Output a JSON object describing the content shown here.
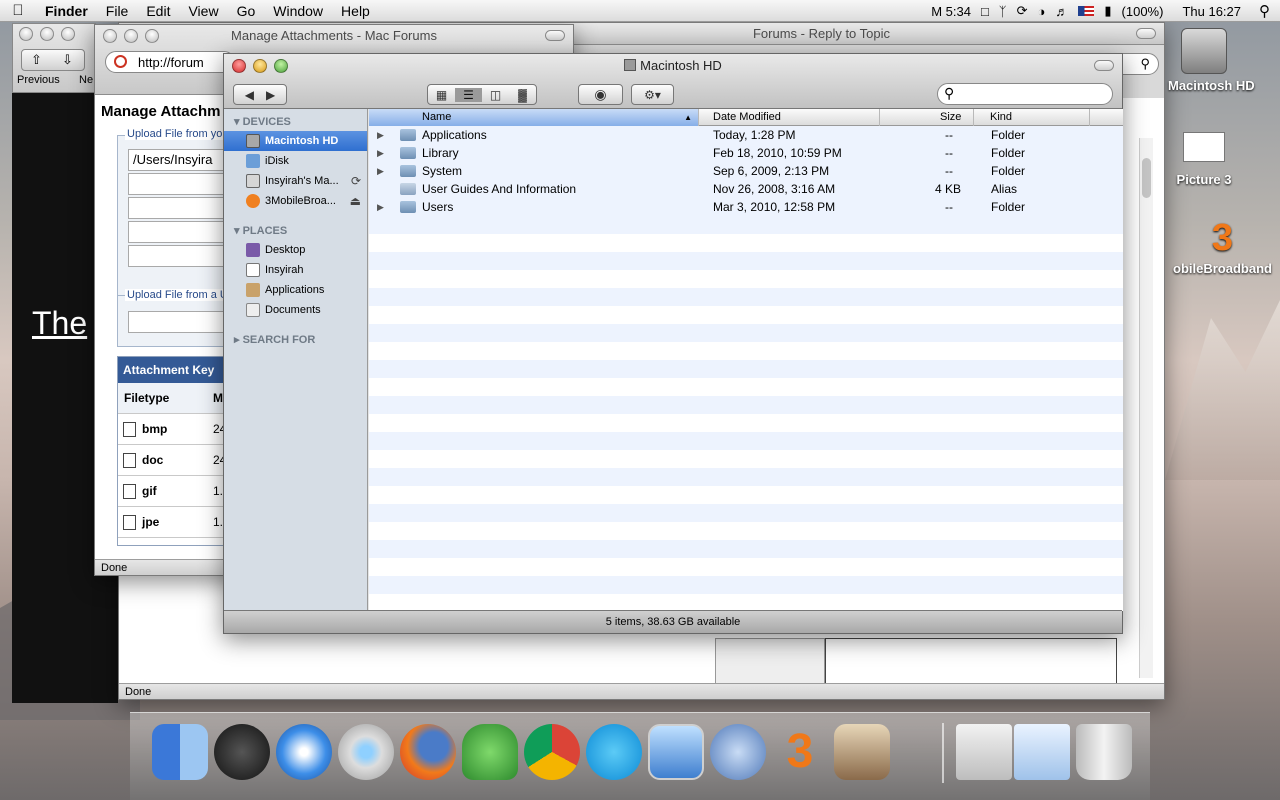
{
  "menubar": {
    "apple": "",
    "app": "Finder",
    "items": [
      "File",
      "Edit",
      "View",
      "Go",
      "Window",
      "Help"
    ],
    "extras": {
      "clock_menu": "M 5:34",
      "battery": "(100%)",
      "datetime": "Thu 16:27"
    }
  },
  "forum_window": {
    "title": "Forums - Reply to Topic",
    "status": "Done",
    "nav": {
      "previous": "Previous",
      "next": "Ne"
    }
  },
  "attachments_window": {
    "title": "Manage Attachments - Mac Forums",
    "url": "http://forum",
    "heading": "Manage Attachm",
    "upload_computer_legend": "Upload File from yo",
    "file_path": "/Users/Insyira",
    "upload_url_legend": "Upload File from a U",
    "key_header": "Attachment Key",
    "key_columns": [
      "Filetype",
      "M"
    ],
    "key_rows": [
      {
        "type": "bmp",
        "size": "24"
      },
      {
        "type": "doc",
        "size": "24"
      },
      {
        "type": "gif",
        "size": "1."
      },
      {
        "type": "jpe",
        "size": "1."
      }
    ],
    "status": "Done"
  },
  "background_page": {
    "text": "The"
  },
  "finder": {
    "title": "Macintosh HD",
    "sidebar": {
      "devices_header": "DEVICES",
      "devices": [
        "Macintosh HD",
        "iDisk",
        "Insyirah's Ma...",
        "3MobileBroa..."
      ],
      "places_header": "PLACES",
      "places": [
        "Desktop",
        "Insyirah",
        "Applications",
        "Documents"
      ],
      "search_header": "SEARCH FOR"
    },
    "columns": [
      "Name",
      "Date Modified",
      "Size",
      "Kind"
    ],
    "rows": [
      {
        "name": "Applications",
        "date": "Today, 1:28 PM",
        "size": "--",
        "kind": "Folder",
        "expandable": true
      },
      {
        "name": "Library",
        "date": "Feb 18, 2010, 10:59 PM",
        "size": "--",
        "kind": "Folder",
        "expandable": true
      },
      {
        "name": "System",
        "date": "Sep 6, 2009, 2:13 PM",
        "size": "--",
        "kind": "Folder",
        "expandable": true
      },
      {
        "name": "User Guides And Information",
        "date": "Nov 26, 2008, 3:16 AM",
        "size": "4 KB",
        "kind": "Alias",
        "expandable": false
      },
      {
        "name": "Users",
        "date": "Mar 3, 2010, 12:58 PM",
        "size": "--",
        "kind": "Folder",
        "expandable": true
      }
    ],
    "status": "5 items, 38.63 GB available"
  },
  "desktop_icons": [
    "Macintosh HD",
    "Picture 3",
    "obileBroadband"
  ],
  "dock_apps": [
    "Finder",
    "Dashboard",
    "Safari",
    "iTunes",
    "Firefox",
    "Adium",
    "Google Chrome",
    "Skype",
    "Preview",
    "QuickTime",
    "3 Mobile Broadband",
    "iPhoto",
    "Documents",
    "Picture",
    "Trash"
  ]
}
